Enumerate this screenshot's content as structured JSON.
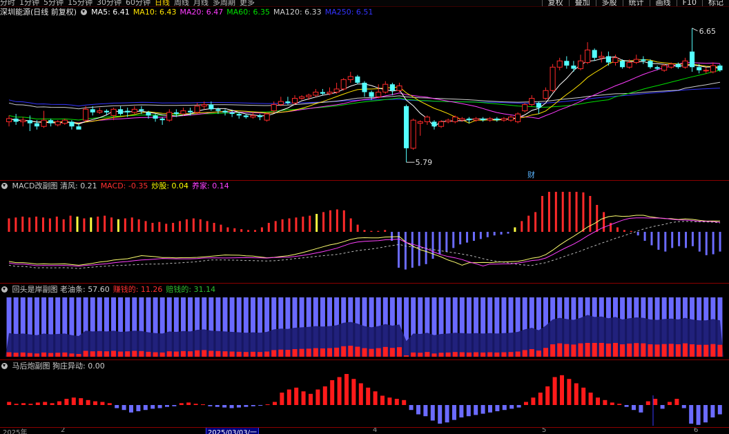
{
  "toolbar": {
    "periods": [
      "分时",
      "1分钟",
      "5分钟",
      "15分钟",
      "30分钟",
      "60分钟",
      "日线",
      "周线",
      "月线",
      "多周期",
      "更多"
    ],
    "active_period": "日线",
    "tools": [
      "复权",
      "叠加",
      "多股",
      "统计",
      "画线",
      "F10",
      "标记"
    ]
  },
  "main_panel": {
    "stock_title": "深圳能源(日线 前复权)",
    "ma": [
      {
        "label": "MA5",
        "value": "6.41",
        "color": "#ffffff"
      },
      {
        "label": "MA10",
        "value": "6.43",
        "color": "#ffe400"
      },
      {
        "label": "MA20",
        "value": "6.47",
        "color": "#ff3cff"
      },
      {
        "label": "MA60",
        "value": "6.35",
        "color": "#00e000"
      },
      {
        "label": "MA120",
        "value": "6.33",
        "color": "#cfcfcf"
      },
      {
        "label": "MA250",
        "value": "6.51",
        "color": "#3434ff"
      }
    ],
    "high_label": "6.65",
    "low_label": "5.79",
    "event_marker": "财"
  },
  "macd_panel": {
    "title": "MACD改副图",
    "items": [
      {
        "label": "清风",
        "value": "0.21",
        "color": "#cfcfcf"
      },
      {
        "label": "MACD",
        "value": "-0.35",
        "color": "#ff3030"
      },
      {
        "label": "炒股",
        "value": "0.04",
        "color": "#ffff00"
      },
      {
        "label": "养家",
        "value": "0.14",
        "color": "#ff40ff"
      }
    ]
  },
  "huitou_panel": {
    "title": "回头是岸副图",
    "items": [
      {
        "label": "老油条",
        "value": "57.60",
        "color": "#cfcfcf"
      },
      {
        "label": "赚钱的",
        "value": "11.26",
        "color": "#ff3030"
      },
      {
        "label": "赔钱的",
        "value": "31.14",
        "color": "#30c030"
      }
    ]
  },
  "mahou_panel": {
    "title": "马后炮副图",
    "items": [
      {
        "label": "狗庄异动",
        "value": "0.00",
        "color": "#cfcfcf"
      }
    ]
  },
  "bottom_axis": {
    "labels": [
      "2025年",
      "2",
      "2025/03/03/一",
      "4",
      "5",
      "6"
    ],
    "selected": "2025/03/03/一"
  },
  "chart_data": {
    "type": "candlestick",
    "price_range": [
      5.79,
      6.65
    ],
    "candles": [
      {
        "o": 6.05,
        "c": 6.07,
        "h": 6.09,
        "l": 6.02
      },
      {
        "o": 6.07,
        "c": 6.05,
        "h": 6.1,
        "l": 6.03
      },
      {
        "o": 6.05,
        "c": 6.06,
        "h": 6.08,
        "l": 6.02
      },
      {
        "o": 6.06,
        "c": 6.04,
        "h": 6.09,
        "l": 5.99
      },
      {
        "o": 6.04,
        "c": 6.02,
        "h": 6.06,
        "l": 6.0
      },
      {
        "o": 6.02,
        "c": 6.06,
        "h": 6.12,
        "l": 6.01
      },
      {
        "o": 6.06,
        "c": 6.04,
        "h": 6.07,
        "l": 6.02
      },
      {
        "o": 6.03,
        "c": 6.05,
        "h": 6.06,
        "l": 6.02
      },
      {
        "o": 6.04,
        "c": 6.06,
        "h": 6.07,
        "l": 6.03
      },
      {
        "o": 6.05,
        "c": 6.02,
        "h": 6.06,
        "l": 6.0
      },
      {
        "o": 6.02,
        "c": 6.0,
        "h": 6.04,
        "l": 6.01
      },
      {
        "o": 6.06,
        "c": 6.13,
        "h": 6.15,
        "l": 6.05
      },
      {
        "o": 6.13,
        "c": 6.11,
        "h": 6.15,
        "l": 6.09
      },
      {
        "o": 6.11,
        "c": 6.12,
        "h": 6.14,
        "l": 6.1
      },
      {
        "o": 6.12,
        "c": 6.11,
        "h": 6.13,
        "l": 6.09
      },
      {
        "o": 6.09,
        "c": 6.13,
        "h": 6.14,
        "l": 6.06
      },
      {
        "o": 6.13,
        "c": 6.1,
        "h": 6.15,
        "l": 6.09
      },
      {
        "o": 6.12,
        "c": 6.11,
        "h": 6.14,
        "l": 6.08
      },
      {
        "o": 6.11,
        "c": 6.13,
        "h": 6.15,
        "l": 6.1
      },
      {
        "o": 6.13,
        "c": 6.12,
        "h": 6.15,
        "l": 6.1
      },
      {
        "o": 6.11,
        "c": 6.09,
        "h": 6.12,
        "l": 6.07
      },
      {
        "o": 6.09,
        "c": 6.07,
        "h": 6.1,
        "l": 6.05
      },
      {
        "o": 6.07,
        "c": 6.06,
        "h": 6.08,
        "l": 6.03
      },
      {
        "o": 6.06,
        "c": 6.11,
        "h": 6.13,
        "l": 6.05
      },
      {
        "o": 6.11,
        "c": 6.1,
        "h": 6.13,
        "l": 6.08
      },
      {
        "o": 6.1,
        "c": 6.12,
        "h": 6.14,
        "l": 6.09
      },
      {
        "o": 6.12,
        "c": 6.11,
        "h": 6.14,
        "l": 6.09
      },
      {
        "o": 6.11,
        "c": 6.15,
        "h": 6.17,
        "l": 6.1
      },
      {
        "o": 6.15,
        "c": 6.16,
        "h": 6.18,
        "l": 6.13
      },
      {
        "o": 6.16,
        "c": 6.13,
        "h": 6.18,
        "l": 6.12
      },
      {
        "o": 6.13,
        "c": 6.12,
        "h": 6.14,
        "l": 6.1
      },
      {
        "o": 6.12,
        "c": 6.11,
        "h": 6.13,
        "l": 6.09
      },
      {
        "o": 6.11,
        "c": 6.1,
        "h": 6.12,
        "l": 6.08
      },
      {
        "o": 6.1,
        "c": 6.09,
        "h": 6.11,
        "l": 6.07
      },
      {
        "o": 6.09,
        "c": 6.08,
        "h": 6.1,
        "l": 6.07
      },
      {
        "o": 6.08,
        "c": 6.09,
        "h": 6.11,
        "l": 6.07
      },
      {
        "o": 6.09,
        "c": 6.08,
        "h": 6.1,
        "l": 6.06
      },
      {
        "o": 6.06,
        "c": 6.1,
        "h": 6.11,
        "l": 6.05
      },
      {
        "o": 6.12,
        "c": 6.16,
        "h": 6.18,
        "l": 6.11
      },
      {
        "o": 6.16,
        "c": 6.18,
        "h": 6.21,
        "l": 6.15
      },
      {
        "o": 6.18,
        "c": 6.17,
        "h": 6.21,
        "l": 6.16
      },
      {
        "o": 6.17,
        "c": 6.2,
        "h": 6.22,
        "l": 6.16
      },
      {
        "o": 6.2,
        "c": 6.21,
        "h": 6.22,
        "l": 6.19
      },
      {
        "o": 6.21,
        "c": 6.22,
        "h": 6.23,
        "l": 6.19
      },
      {
        "o": 6.22,
        "c": 6.24,
        "h": 6.26,
        "l": 6.21
      },
      {
        "o": 6.24,
        "c": 6.23,
        "h": 6.26,
        "l": 6.22
      },
      {
        "o": 6.23,
        "c": 6.24,
        "h": 6.27,
        "l": 6.22
      },
      {
        "o": 6.24,
        "c": 6.26,
        "h": 6.3,
        "l": 6.23
      },
      {
        "o": 6.26,
        "c": 6.32,
        "h": 6.33,
        "l": 6.25
      },
      {
        "o": 6.32,
        "c": 6.34,
        "h": 6.37,
        "l": 6.3
      },
      {
        "o": 6.34,
        "c": 6.3,
        "h": 6.35,
        "l": 6.29
      },
      {
        "o": 6.3,
        "c": 6.24,
        "h": 6.31,
        "l": 6.21
      },
      {
        "o": 6.24,
        "c": 6.21,
        "h": 6.25,
        "l": 6.19
      },
      {
        "o": 6.21,
        "c": 6.24,
        "h": 6.29,
        "l": 6.2
      },
      {
        "o": 6.24,
        "c": 6.29,
        "h": 6.31,
        "l": 6.23
      },
      {
        "o": 6.29,
        "c": 6.25,
        "h": 6.3,
        "l": 6.22
      },
      {
        "o": 6.25,
        "c": 6.28,
        "h": 6.3,
        "l": 6.24
      },
      {
        "o": 6.15,
        "c": 5.88,
        "h": 6.16,
        "l": 5.79
      },
      {
        "o": 5.88,
        "c": 6.06,
        "h": 6.07,
        "l": 5.87
      },
      {
        "o": 6.04,
        "c": 6.05,
        "h": 6.06,
        "l": 5.96
      },
      {
        "o": 6.05,
        "c": 6.08,
        "h": 6.09,
        "l": 6.03
      },
      {
        "o": 6.05,
        "c": 6.02,
        "h": 6.06,
        "l": 6.0
      },
      {
        "o": 6.02,
        "c": 6.05,
        "h": 6.06,
        "l": 6.01
      },
      {
        "o": 6.05,
        "c": 6.06,
        "h": 6.07,
        "l": 6.04
      },
      {
        "o": 6.05,
        "c": 6.08,
        "h": 6.09,
        "l": 6.04
      },
      {
        "o": 6.06,
        "c": 6.07,
        "h": 6.08,
        "l": 6.05
      },
      {
        "o": 6.07,
        "c": 6.06,
        "h": 6.08,
        "l": 6.04
      },
      {
        "o": 6.06,
        "c": 6.07,
        "h": 6.08,
        "l": 6.05
      },
      {
        "o": 6.07,
        "c": 6.06,
        "h": 6.08,
        "l": 6.05
      },
      {
        "o": 6.06,
        "c": 6.07,
        "h": 6.08,
        "l": 6.05
      },
      {
        "o": 6.07,
        "c": 6.06,
        "h": 6.08,
        "l": 6.05
      },
      {
        "o": 6.06,
        "c": 6.07,
        "h": 6.08,
        "l": 6.05
      },
      {
        "o": 6.06,
        "c": 6.08,
        "h": 6.09,
        "l": 6.05
      },
      {
        "o": 6.05,
        "c": 6.1,
        "h": 6.11,
        "l": 6.04
      },
      {
        "o": 6.12,
        "c": 6.16,
        "h": 6.17,
        "l": 6.11
      },
      {
        "o": 6.16,
        "c": 6.2,
        "h": 6.22,
        "l": 6.15
      },
      {
        "o": 6.17,
        "c": 6.14,
        "h": 6.18,
        "l": 6.1
      },
      {
        "o": 6.2,
        "c": 6.25,
        "h": 6.27,
        "l": 6.19
      },
      {
        "o": 6.25,
        "c": 6.4,
        "h": 6.42,
        "l": 6.24
      },
      {
        "o": 6.4,
        "c": 6.44,
        "h": 6.46,
        "l": 6.38
      },
      {
        "o": 6.44,
        "c": 6.41,
        "h": 6.47,
        "l": 6.39
      },
      {
        "o": 6.41,
        "c": 6.39,
        "h": 6.44,
        "l": 6.37
      },
      {
        "o": 6.39,
        "c": 6.44,
        "h": 6.48,
        "l": 6.38
      },
      {
        "o": 6.43,
        "c": 6.51,
        "h": 6.56,
        "l": 6.42
      },
      {
        "o": 6.51,
        "c": 6.46,
        "h": 6.52,
        "l": 6.44
      },
      {
        "o": 6.46,
        "c": 6.47,
        "h": 6.5,
        "l": 6.43
      },
      {
        "o": 6.47,
        "c": 6.43,
        "h": 6.5,
        "l": 6.41
      },
      {
        "o": 6.43,
        "c": 6.46,
        "h": 6.48,
        "l": 6.41
      },
      {
        "o": 6.44,
        "c": 6.4,
        "h": 6.45,
        "l": 6.39
      },
      {
        "o": 6.4,
        "c": 6.43,
        "h": 6.45,
        "l": 6.39
      },
      {
        "o": 6.43,
        "c": 6.45,
        "h": 6.48,
        "l": 6.42
      },
      {
        "o": 6.45,
        "c": 6.44,
        "h": 6.47,
        "l": 6.42
      },
      {
        "o": 6.44,
        "c": 6.4,
        "h": 6.45,
        "l": 6.39
      },
      {
        "o": 6.4,
        "c": 6.39,
        "h": 6.41,
        "l": 6.38
      },
      {
        "o": 6.38,
        "c": 6.41,
        "h": 6.42,
        "l": 6.37
      },
      {
        "o": 6.4,
        "c": 6.42,
        "h": 6.43,
        "l": 6.39
      },
      {
        "o": 6.42,
        "c": 6.4,
        "h": 6.43,
        "l": 6.39
      },
      {
        "o": 6.4,
        "c": 6.44,
        "h": 6.46,
        "l": 6.39
      },
      {
        "o": 6.5,
        "c": 6.4,
        "h": 6.65,
        "l": 6.37
      },
      {
        "o": 6.4,
        "c": 6.38,
        "h": 6.42,
        "l": 6.36
      },
      {
        "o": 6.38,
        "c": 6.38,
        "h": 6.4,
        "l": 6.36
      },
      {
        "o": 6.37,
        "c": 6.41,
        "h": 6.43,
        "l": 6.36
      },
      {
        "o": 6.41,
        "c": 6.38,
        "h": 6.42,
        "l": 6.37
      }
    ],
    "macd_hist": [
      0.15,
      0.16,
      0.17,
      0.16,
      0.17,
      0.16,
      0.15,
      0.17,
      0.14,
      0.18,
      0.17,
      0.15,
      0.16,
      0.17,
      0.18,
      0.16,
      0.14,
      0.15,
      0.16,
      0.14,
      0.12,
      0.1,
      0.11,
      0.09,
      0.1,
      0.12,
      0.14,
      0.15,
      0.14,
      0.12,
      0.1,
      0.08,
      0.05,
      0.04,
      0.03,
      0.02,
      0.02,
      0.05,
      0.1,
      0.12,
      0.14,
      0.15,
      0.16,
      0.17,
      0.18,
      0.2,
      0.22,
      0.24,
      0.25,
      0.24,
      0.15,
      0.08,
      0.02,
      0.01,
      0.01,
      0.02,
      -0.1,
      -0.4,
      -0.42,
      -0.4,
      -0.38,
      -0.36,
      -0.3,
      -0.25,
      -0.22,
      -0.18,
      -0.14,
      -0.12,
      -0.1,
      -0.08,
      -0.06,
      -0.04,
      -0.03,
      -0.02,
      0.05,
      0.12,
      0.18,
      0.22,
      0.4,
      0.45,
      0.48,
      0.5,
      0.48,
      0.46,
      0.44,
      0.4,
      0.3,
      0.22,
      0.1,
      0.05,
      0.02,
      0.01,
      -0.04,
      -0.1,
      -0.15,
      -0.2,
      -0.22,
      -0.18,
      -0.16,
      -0.18,
      -0.16,
      -0.22,
      -0.26,
      -0.25,
      -0.22
    ],
    "macd_yellow_bars": [
      10,
      12,
      16,
      45,
      71,
      74
    ],
    "huitou": [
      57.6
    ],
    "mahou_bars": [
      0.05,
      0.02,
      0.03,
      0.02,
      0.04,
      0.05,
      0.03,
      0.06,
      0.1,
      0.12,
      0.11,
      0.08,
      0.06,
      0.05,
      0.03,
      -0.05,
      -0.08,
      -0.12,
      -0.1,
      -0.08,
      -0.06,
      -0.05,
      -0.03,
      -0.02,
      0.03,
      0.04,
      0.02,
      0.01,
      -0.02,
      -0.03,
      -0.04,
      -0.05,
      -0.04,
      -0.03,
      -0.02,
      -0.01,
      0.01,
      0.05,
      0.2,
      0.25,
      0.28,
      0.22,
      0.18,
      0.25,
      0.3,
      0.4,
      0.45,
      0.5,
      0.42,
      0.35,
      0.28,
      0.22,
      0.15,
      0.12,
      0.1,
      0.08,
      -0.08,
      -0.15,
      -0.18,
      -0.25,
      -0.3,
      -0.28,
      -0.24,
      -0.2,
      -0.18,
      -0.16,
      -0.14,
      -0.12,
      -0.1,
      -0.08,
      -0.06,
      -0.04,
      0.05,
      0.12,
      0.2,
      0.3,
      0.45,
      0.48,
      0.42,
      0.35,
      0.28,
      0.2,
      0.12,
      0.08,
      0.04,
      0.02,
      -0.03,
      -0.08,
      -0.12,
      0.06,
      0.1,
      -0.06,
      0.05,
      0.1,
      -0.05,
      -0.3,
      -0.32,
      -0.28,
      -0.2,
      -0.15
    ]
  }
}
